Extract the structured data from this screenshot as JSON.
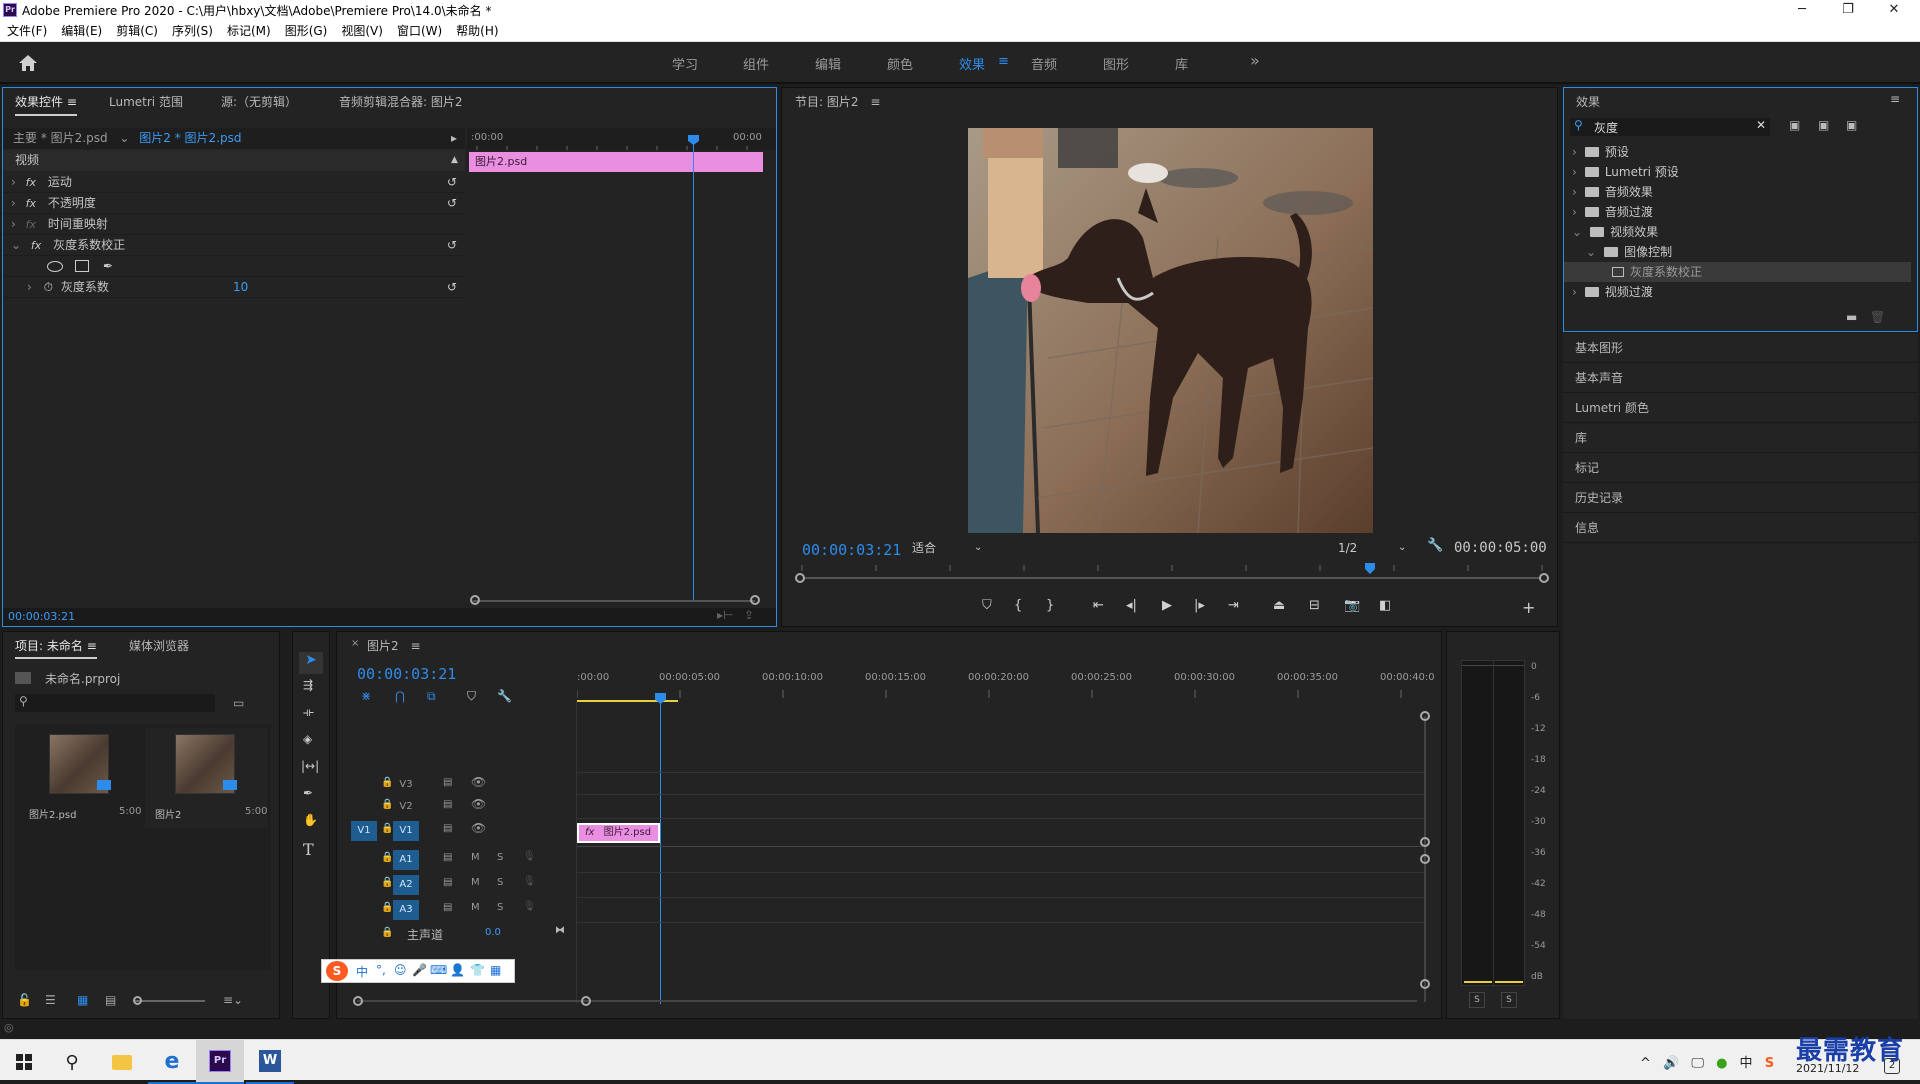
{
  "window": {
    "title": "Adobe Premiere Pro 2020 - C:\\用户\\hbxy\\文档\\Adobe\\Premiere Pro\\14.0\\未命名 *",
    "logo_text": "Pr"
  },
  "menu": [
    "文件(F)",
    "编辑(E)",
    "剪辑(C)",
    "序列(S)",
    "标记(M)",
    "图形(G)",
    "视图(V)",
    "窗口(W)",
    "帮助(H)"
  ],
  "workspaces": {
    "tabs": [
      "学习",
      "组件",
      "编辑",
      "颜色",
      "效果",
      "音频",
      "图形",
      "库"
    ],
    "active": "效果",
    "more": "»"
  },
  "effect_controls": {
    "tabs": [
      "效果控件",
      "Lumetri 范围",
      "源:（无剪辑）",
      "音频剪辑混合器: 图片2"
    ],
    "master": "主要 * 图片2.psd",
    "clip": "图片2 * 图片2.psd",
    "ruler_start": ":00:00",
    "ruler_end": "00:00",
    "clip_bar": "图片2.psd",
    "section": "视频",
    "properties": [
      "运动",
      "不透明度",
      "时间重映射",
      "灰度系数校正"
    ],
    "param_name": "灰度系数",
    "param_value": "10",
    "fx": "fx",
    "timecode": "00:00:03:21"
  },
  "program": {
    "title": "节目: 图片2",
    "timecode": "00:00:03:21",
    "fit": "适合",
    "quality": "1/2",
    "duration": "00:00:05:00"
  },
  "effects_panel": {
    "title": "效果",
    "search": "灰度",
    "tree": [
      {
        "label": "预设",
        "level": 0,
        "open": false
      },
      {
        "label": "Lumetri 预设",
        "level": 0,
        "open": false
      },
      {
        "label": "音频效果",
        "level": 0,
        "open": false
      },
      {
        "label": "音频过渡",
        "level": 0,
        "open": false
      },
      {
        "label": "视频效果",
        "level": 0,
        "open": true
      },
      {
        "label": "图像控制",
        "level": 1,
        "open": true
      },
      {
        "label": "灰度系数校正",
        "level": 2,
        "open": false
      },
      {
        "label": "视频过渡",
        "level": 0,
        "open": false
      }
    ]
  },
  "right_panels": [
    "基本图形",
    "基本声音",
    "Lumetri 颜色",
    "库",
    "标记",
    "历史记录",
    "信息"
  ],
  "project": {
    "tabs": [
      "项目: 未命名",
      "媒体浏览器"
    ],
    "file": "未命名.prproj",
    "items": [
      {
        "name": "图片2.psd",
        "duration": "5:00"
      },
      {
        "name": "图片2",
        "duration": "5:00"
      }
    ]
  },
  "timeline": {
    "tab": "图片2",
    "close": "×",
    "timecode": "00:00:03:21",
    "ruler": [
      ":00:00",
      "00:00:05:00",
      "00:00:10:00",
      "00:00:15:00",
      "00:00:20:00",
      "00:00:25:00",
      "00:00:30:00",
      "00:00:35:00",
      "00:00:40:0"
    ],
    "video_tracks": [
      "V3",
      "V2",
      "V1"
    ],
    "audio_tracks": [
      "A1",
      "A2",
      "A3"
    ],
    "source_patch": "V1",
    "mute_label": "M",
    "solo_label": "S",
    "clip": "图片2.psd",
    "clip_fx": "fx",
    "master": "主声道",
    "master_value": "0.0"
  },
  "meter": {
    "scale": [
      "0",
      "-6",
      "-12",
      "-18",
      "-24",
      "-30",
      "-36",
      "-42",
      "-48",
      "-54",
      "dB"
    ],
    "solo": [
      "S",
      "S"
    ]
  },
  "ime_bar": {
    "logo": "S",
    "items": [
      "中",
      "°,",
      "☺",
      "🎤",
      "⌨",
      "👤",
      "👕",
      "▦"
    ]
  },
  "taskbar": {
    "date": "2021/11/12",
    "tray": [
      "^",
      "🔊",
      "🖵",
      "●",
      "中",
      "S"
    ],
    "badge": "2"
  },
  "watermark": "最需教育"
}
